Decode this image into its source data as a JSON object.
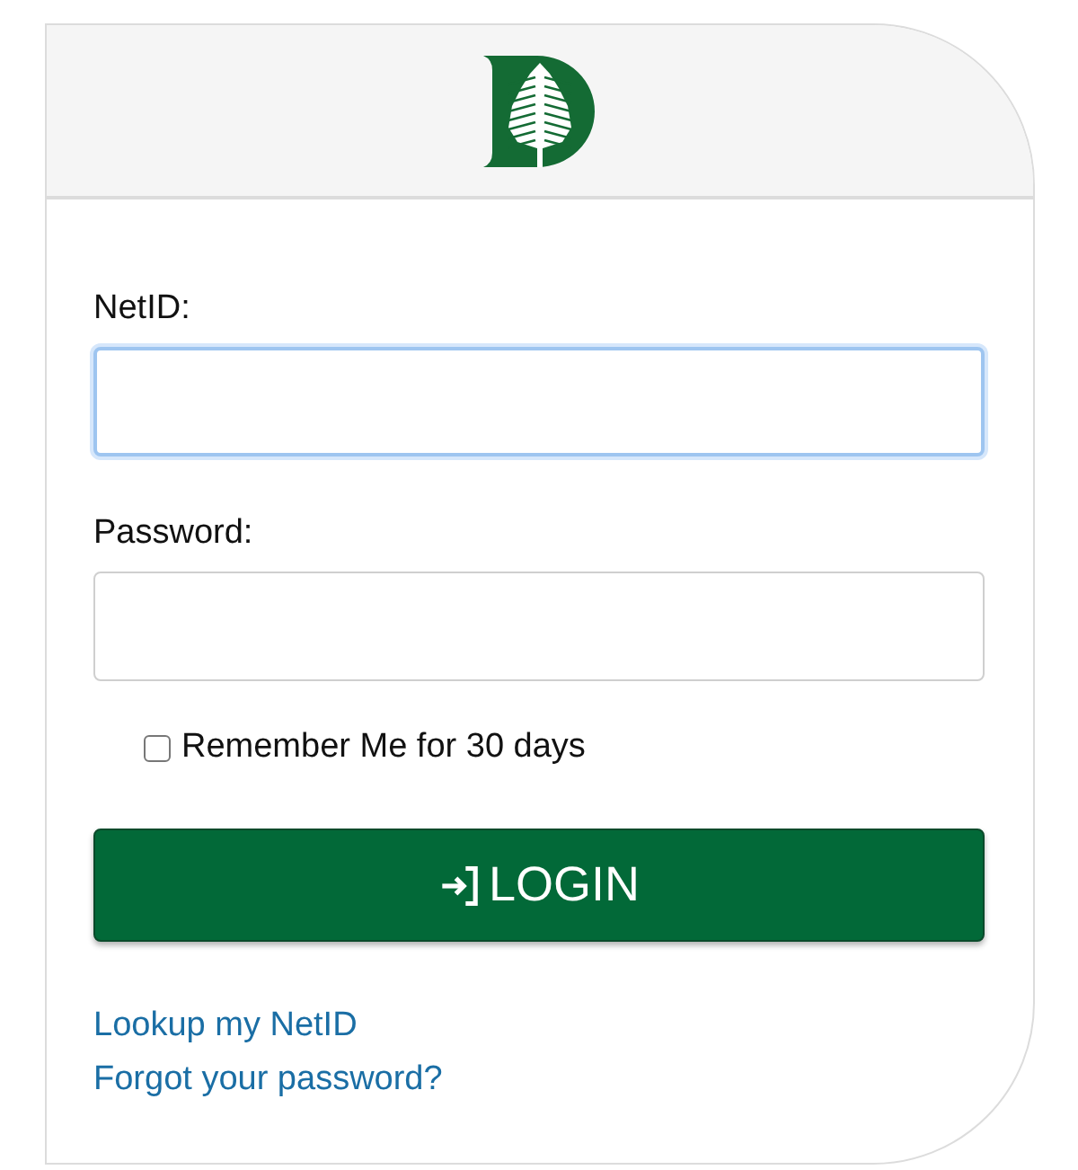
{
  "fields": [
    {
      "label": "NetID:",
      "focused": true
    },
    {
      "label": "Password:",
      "focused": false
    }
  ],
  "remember": {
    "label": "Remember Me for 30 days",
    "checked": false
  },
  "login_button": {
    "label": "LOGIN"
  },
  "links": [
    "Lookup my NetID",
    "Forgot your password?"
  ]
}
